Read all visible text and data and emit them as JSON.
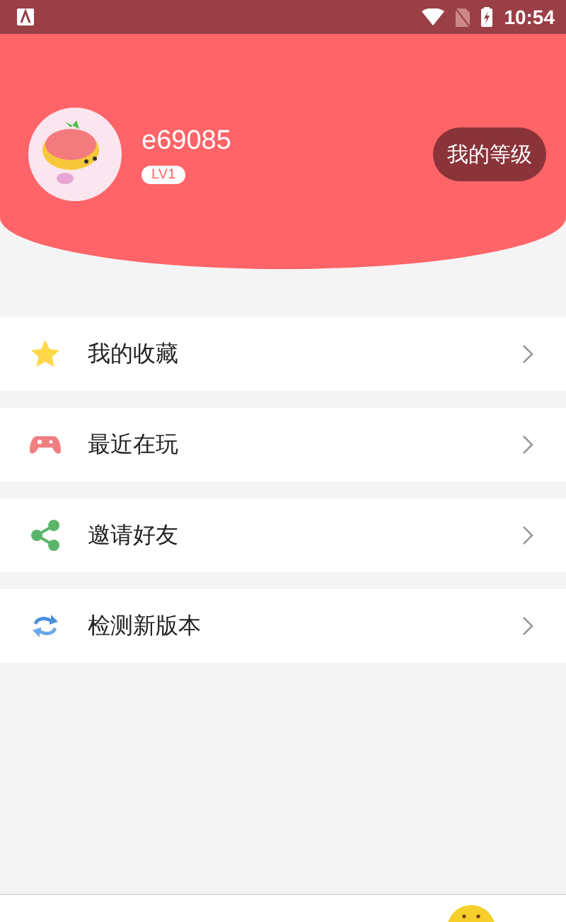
{
  "status_bar": {
    "time": "10:54"
  },
  "profile": {
    "username": "e69085",
    "level_badge": "LV1",
    "level_button": "我的等级"
  },
  "menu": [
    {
      "label": "我的收藏",
      "kind": "star"
    },
    {
      "label": "最近在玩",
      "kind": "gamepad"
    },
    {
      "label": "邀请好友",
      "kind": "share"
    },
    {
      "label": "检测新版本",
      "kind": "refresh"
    }
  ]
}
